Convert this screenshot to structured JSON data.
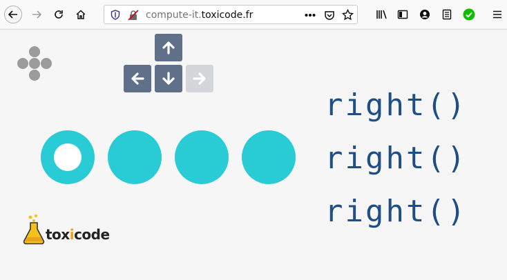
{
  "browser": {
    "url_prefix": "compute-it.",
    "url_domain": "toxicode.fr"
  },
  "game": {
    "controls": {
      "up": {
        "icon": "arrow-up-icon",
        "state": "active"
      },
      "left": {
        "icon": "arrow-left-icon",
        "state": "active"
      },
      "down": {
        "icon": "arrow-down-icon",
        "state": "active"
      },
      "right": {
        "icon": "arrow-right-icon",
        "state": "disabled"
      }
    },
    "cells": [
      {
        "color": "#29cbd4",
        "has_robot": true
      },
      {
        "color": "#29cbd4",
        "has_robot": false
      },
      {
        "color": "#29cbd4",
        "has_robot": false
      },
      {
        "color": "#29cbd4",
        "has_robot": false
      }
    ],
    "code": [
      "right()",
      "right()",
      "right()"
    ]
  },
  "logo": {
    "text_before": "tox",
    "text_accent": "i",
    "text_after": "code"
  },
  "colors": {
    "cell": "#29cbd4",
    "code": "#1f4e87",
    "key_active": "#5f7088",
    "key_disabled": "#d4d6d9",
    "accent_orange": "#e8a21b"
  }
}
